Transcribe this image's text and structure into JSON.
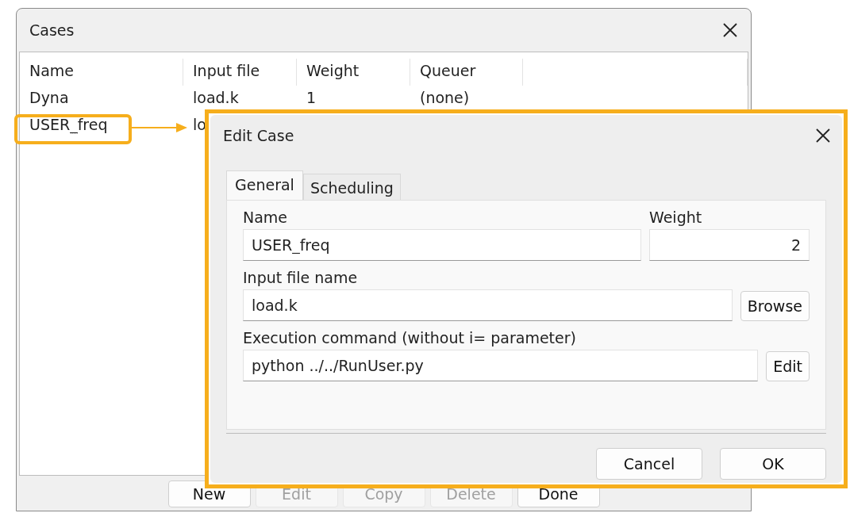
{
  "cases_window": {
    "title": "Cases",
    "columns": [
      "Name",
      "Input file",
      "Weight",
      "Queuer"
    ],
    "rows": [
      {
        "cells": [
          "Dyna",
          "load.k",
          "1",
          "(none)"
        ],
        "selected": false
      },
      {
        "cells": [
          "USER_freq",
          "lo"
        ],
        "selected": true
      }
    ],
    "buttons": [
      {
        "label": "New",
        "disabled": false
      },
      {
        "label": "Edit",
        "disabled": true
      },
      {
        "label": "Copy",
        "disabled": true
      },
      {
        "label": "Delete",
        "disabled": true
      },
      {
        "label": "Done",
        "disabled": false
      }
    ]
  },
  "edit_dialog": {
    "title": "Edit Case",
    "tabs": [
      {
        "label": "General",
        "selected": true
      },
      {
        "label": "Scheduling",
        "selected": false
      }
    ],
    "name": {
      "label": "Name",
      "value": "USER_freq"
    },
    "weight": {
      "label": "Weight",
      "value": "2"
    },
    "input_file": {
      "label": "Input file name",
      "value": "load.k",
      "button": "Browse"
    },
    "command": {
      "label": "Execution command (without i= parameter)",
      "value": "python ../../RunUser.py",
      "button": "Edit"
    },
    "buttons": [
      "Cancel",
      "OK"
    ]
  }
}
